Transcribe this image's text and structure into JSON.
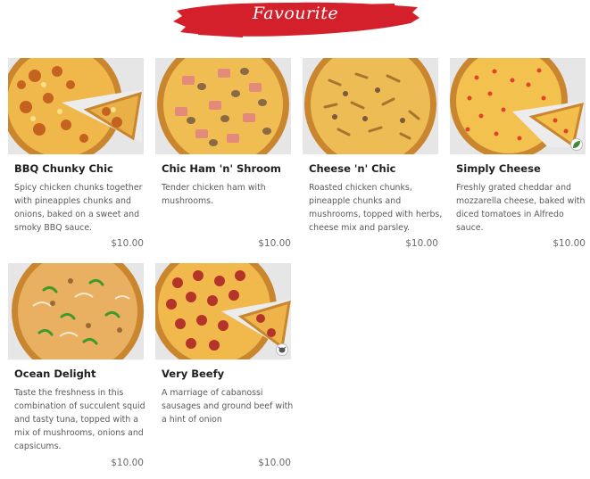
{
  "header": {
    "title": "Favourite"
  },
  "colors": {
    "banner": "#d4202a",
    "crust": "#e4a64a",
    "paper": "#e7e7e7"
  },
  "items": [
    {
      "name": "BBQ Chunky Chic",
      "description": "Spicy chicken chunks together with pineapples chunks and onions, baked on a sweet and smoky BBQ sauce.",
      "price": "$10.00",
      "badge": ""
    },
    {
      "name": "Chic Ham 'n' Shroom",
      "description": "Tender chicken ham with mushrooms.",
      "price": "$10.00",
      "badge": ""
    },
    {
      "name": "Cheese 'n' Chic",
      "description": "Roasted chicken chunks, pineapple chunks and mushrooms, topped with herbs, cheese mix and parsley.",
      "price": "$10.00",
      "badge": ""
    },
    {
      "name": "Simply Cheese",
      "description": "Freshly grated cheddar and mozzarella cheese, baked with diced tomatoes in Alfredo sauce.",
      "price": "$10.00",
      "badge": "vegetarian-leaf-icon"
    },
    {
      "name": "Ocean Delight",
      "description": "Taste the freshness in this combination of succulent squid and tasty tuna, topped with a mix of mushrooms, onions and capsicums.",
      "price": "$10.00",
      "badge": ""
    },
    {
      "name": "Very Beefy",
      "description": "A marriage of cabanossi sausages and ground beef with a hint of onion",
      "price": "$10.00",
      "badge": "beef-icon"
    }
  ]
}
